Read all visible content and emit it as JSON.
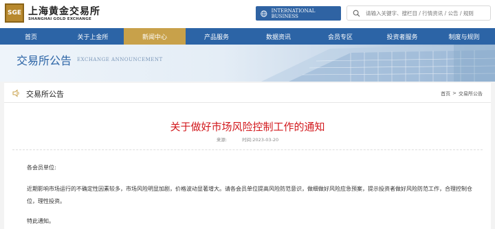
{
  "header": {
    "logo_cn": "上海黄金交易所",
    "logo_en": "SHANGHAI GOLD EXCHANGE",
    "logo_mark": "SGE",
    "intl_button": "INTERNATIONAL BUSINESS",
    "search_placeholder": "请输入关键字、搜栏目 / 行情资讯 / 公告 / 规则"
  },
  "nav": {
    "items": [
      {
        "label": "首页"
      },
      {
        "label": "关于上金所"
      },
      {
        "label": "新闻中心"
      },
      {
        "label": "产品服务"
      },
      {
        "label": "数据资讯"
      },
      {
        "label": "会员专区"
      },
      {
        "label": "投资者服务"
      },
      {
        "label": "制度与规则"
      }
    ],
    "active_index": 2
  },
  "banner": {
    "title": "交易所公告",
    "subtitle": "EXCHANGE ANNOUNCEMENT"
  },
  "section": {
    "title": "交易所公告",
    "breadcrumb": {
      "home": "首页",
      "separator": ">",
      "current": "交易所公告"
    }
  },
  "article": {
    "title": "关于做好市场风险控制工作的通知",
    "source_label": "来源:",
    "time_label": "时间:2023-03-20",
    "greeting": "各会员单位:",
    "body": "近期影响市场运行的不确定性因素较多，市场风险明显加剧，价格波动显著增大。请各会员单位提高风险防范意识，做细做好风险应急预案，提示投资者做好风险防范工作，合理控制仓位，理性投资。",
    "closing": "特此通知。"
  },
  "colors": {
    "brand_blue": "#2c64a6",
    "active_gold": "#c8a14a",
    "title_red": "#d2181c"
  }
}
